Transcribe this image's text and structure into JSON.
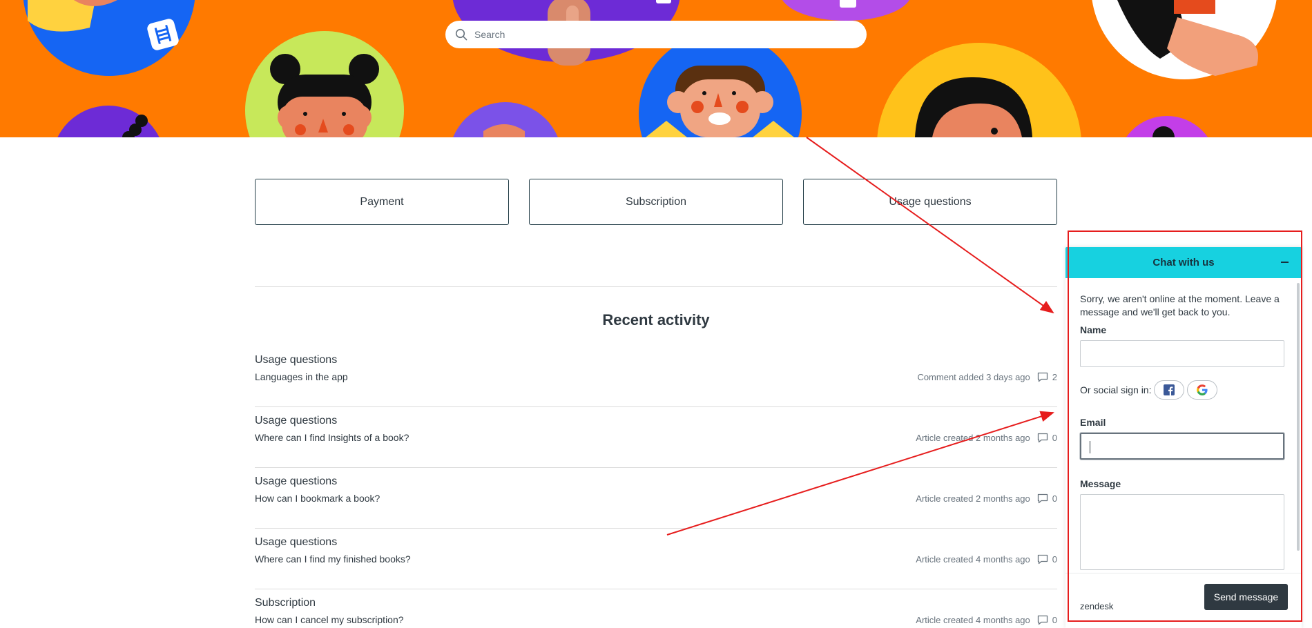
{
  "search": {
    "placeholder": "Search"
  },
  "blocks": [
    {
      "label": "Payment"
    },
    {
      "label": "Subscription"
    },
    {
      "label": "Usage questions"
    }
  ],
  "recent": {
    "title": "Recent activity",
    "items": [
      {
        "category": "Usage questions",
        "article": "Languages in the app",
        "meta": "Comment added 3 days ago",
        "comments": "2"
      },
      {
        "category": "Usage questions",
        "article": "Where can I find Insights of a book?",
        "meta": "Article created 2 months ago",
        "comments": "0"
      },
      {
        "category": "Usage questions",
        "article": "How can I bookmark a book?",
        "meta": "Article created 2 months ago",
        "comments": "0"
      },
      {
        "category": "Usage questions",
        "article": "Where can I find my finished books?",
        "meta": "Article created 4 months ago",
        "comments": "0"
      },
      {
        "category": "Subscription",
        "article": "How can I cancel my subscription?",
        "meta": "Article created 4 months ago",
        "comments": "0"
      }
    ]
  },
  "chat": {
    "title": "Chat with us",
    "notice": "Sorry, we aren't online at the moment. Leave a message and we'll get back to you.",
    "name_label": "Name",
    "name_value": "",
    "social_label": "Or social sign in:",
    "email_label": "Email",
    "email_value": "",
    "message_label": "Message",
    "message_value": "",
    "brand": "zendesk",
    "send_label": "Send message"
  },
  "colors": {
    "banner": "#ff7a00",
    "chat_header": "#17d1e0",
    "send_button": "#2f3941",
    "annotation": "#e61d1d"
  },
  "icons": {
    "search": "magnifier-icon",
    "comment": "speech-bubble-icon",
    "minimize": "minus-icon",
    "facebook": "facebook-icon",
    "google": "google-icon"
  }
}
